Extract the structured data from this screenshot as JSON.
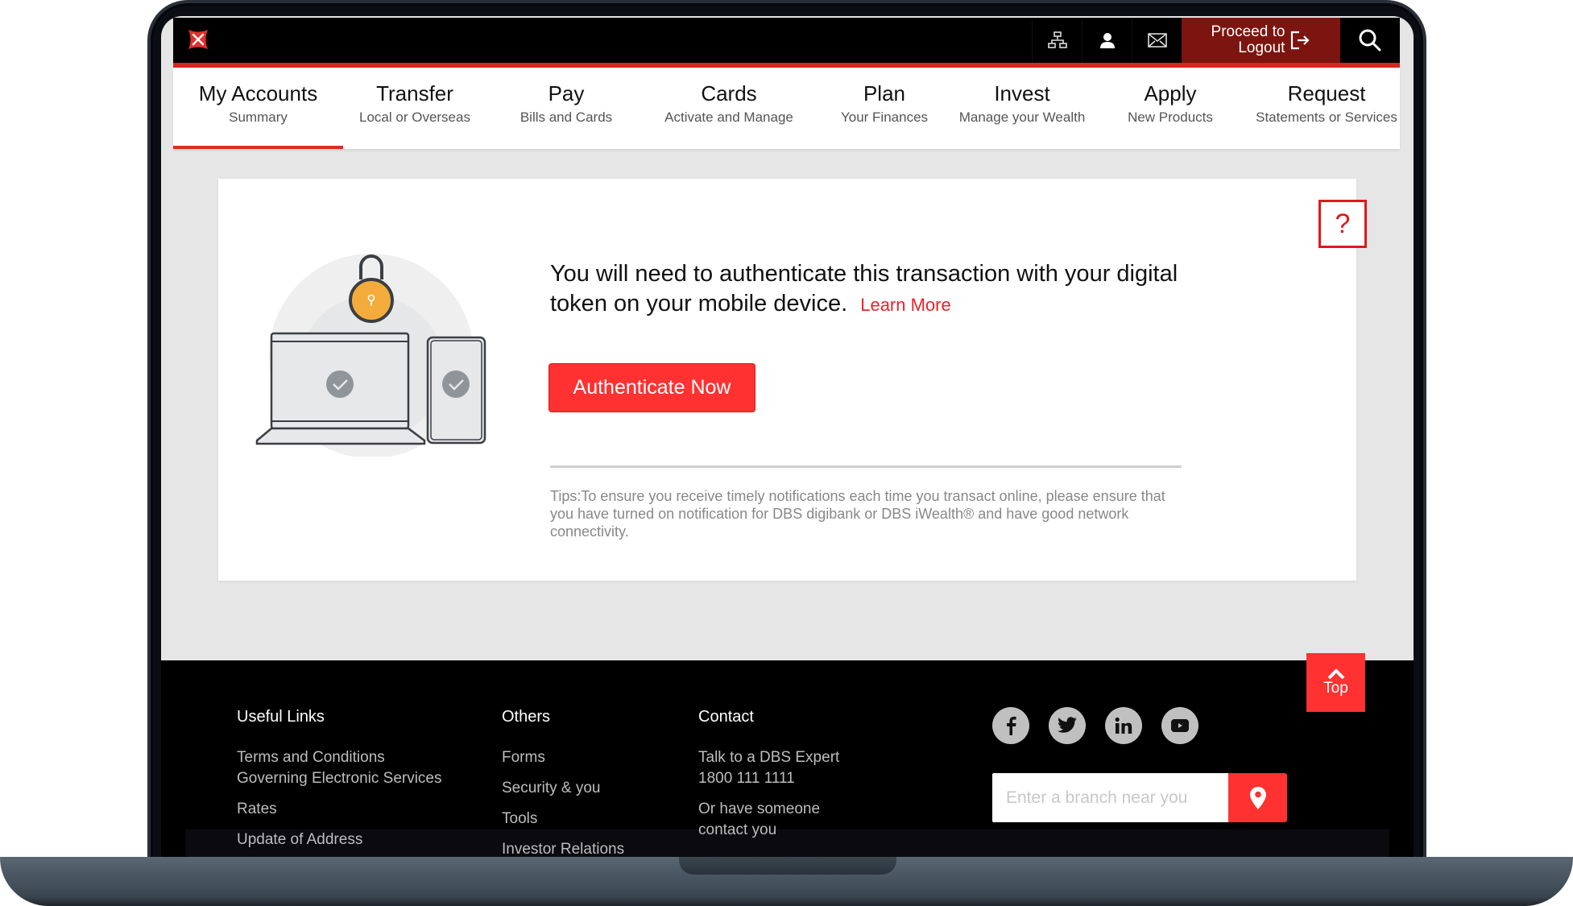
{
  "header": {
    "logo": "dbs-logo",
    "icons": [
      "sitemap-icon",
      "profile-icon",
      "mail-icon"
    ],
    "logout": {
      "line1": "Proceed to",
      "line2": "Logout"
    },
    "search": "search-icon",
    "accent_color": "#d4291f"
  },
  "nav": {
    "items": [
      {
        "title": "My Accounts",
        "subtitle": "Summary",
        "active": true
      },
      {
        "title": "Transfer",
        "subtitle": "Local or Overseas"
      },
      {
        "title": "Pay",
        "subtitle": "Bills and Cards"
      },
      {
        "title": "Cards",
        "subtitle": "Activate and Manage"
      },
      {
        "title": "Plan",
        "subtitle": "Your Finances"
      },
      {
        "title": "Invest",
        "subtitle": "Manage your Wealth"
      },
      {
        "title": "Apply",
        "subtitle": "New Products"
      },
      {
        "title": "Request",
        "subtitle": "Statements or Services"
      }
    ]
  },
  "main": {
    "help_label": "?",
    "message": "You will need to authenticate this transaction with your digital token on your mobile device.",
    "learn_more": "Learn More",
    "authenticate_button": "Authenticate Now",
    "tips": "Tips:To ensure you receive timely notifications each time you transact online, please ensure that you have turned on notification for DBS digibank or DBS iWealth® and have good network connectivity.",
    "button_color": "#ff3131"
  },
  "footer": {
    "useful_links": {
      "heading": "Useful Links",
      "items": [
        "Terms and Conditions",
        "Governing Electronic Services",
        "Rates",
        "Update of Address"
      ]
    },
    "others": {
      "heading": "Others",
      "items": [
        "Forms",
        "Security & you",
        "Tools",
        "Investor Relations"
      ]
    },
    "contact": {
      "heading": "Contact",
      "expert_line1": "Talk to a DBS Expert",
      "expert_line2": "1800 111 1111",
      "callback_line1": "Or have someone",
      "callback_line2": "contact you"
    },
    "social": [
      "facebook-icon",
      "twitter-icon",
      "linkedin-icon",
      "youtube-icon"
    ],
    "branch_search": {
      "placeholder": "Enter a branch near you",
      "value": ""
    },
    "top_button": "Top"
  }
}
